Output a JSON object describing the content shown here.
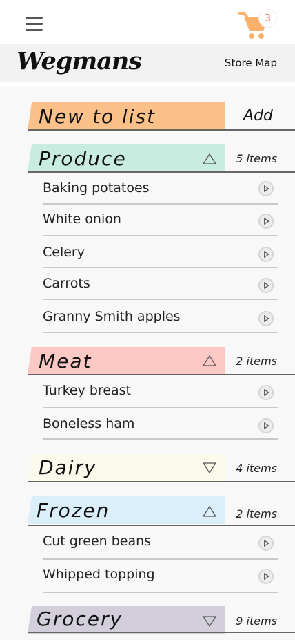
{
  "header": {
    "cart_count": "3",
    "brand": "Wegmans",
    "store_map_label": "Store Map"
  },
  "new_to_list": {
    "label": "New to list",
    "add_label": "Add",
    "color": "#fbc189"
  },
  "categories": [
    {
      "name": "Produce",
      "count": "5 items",
      "expanded": true,
      "color": "#c8ecdf",
      "items": [
        "Baking potatoes",
        "White onion",
        "Celery",
        "Carrots",
        "Granny Smith apples"
      ]
    },
    {
      "name": "Meat",
      "count": "2 items",
      "expanded": true,
      "color": "#fbc8c3",
      "items": [
        "Turkey breast",
        "Boneless ham"
      ]
    },
    {
      "name": "Dairy",
      "count": "4 items",
      "expanded": false,
      "color": "#fcfaeb",
      "items": []
    },
    {
      "name": "Frozen",
      "count": "2 items",
      "expanded": true,
      "color": "#dbeffb",
      "items": [
        "Cut green beans",
        "Whipped topping"
      ]
    },
    {
      "name": "Grocery",
      "count": "9 items",
      "expanded": false,
      "color": "#d2ceda",
      "items": []
    }
  ],
  "colors": {
    "accent": "#fbb16b",
    "badge_text": "#ee7a6c"
  }
}
